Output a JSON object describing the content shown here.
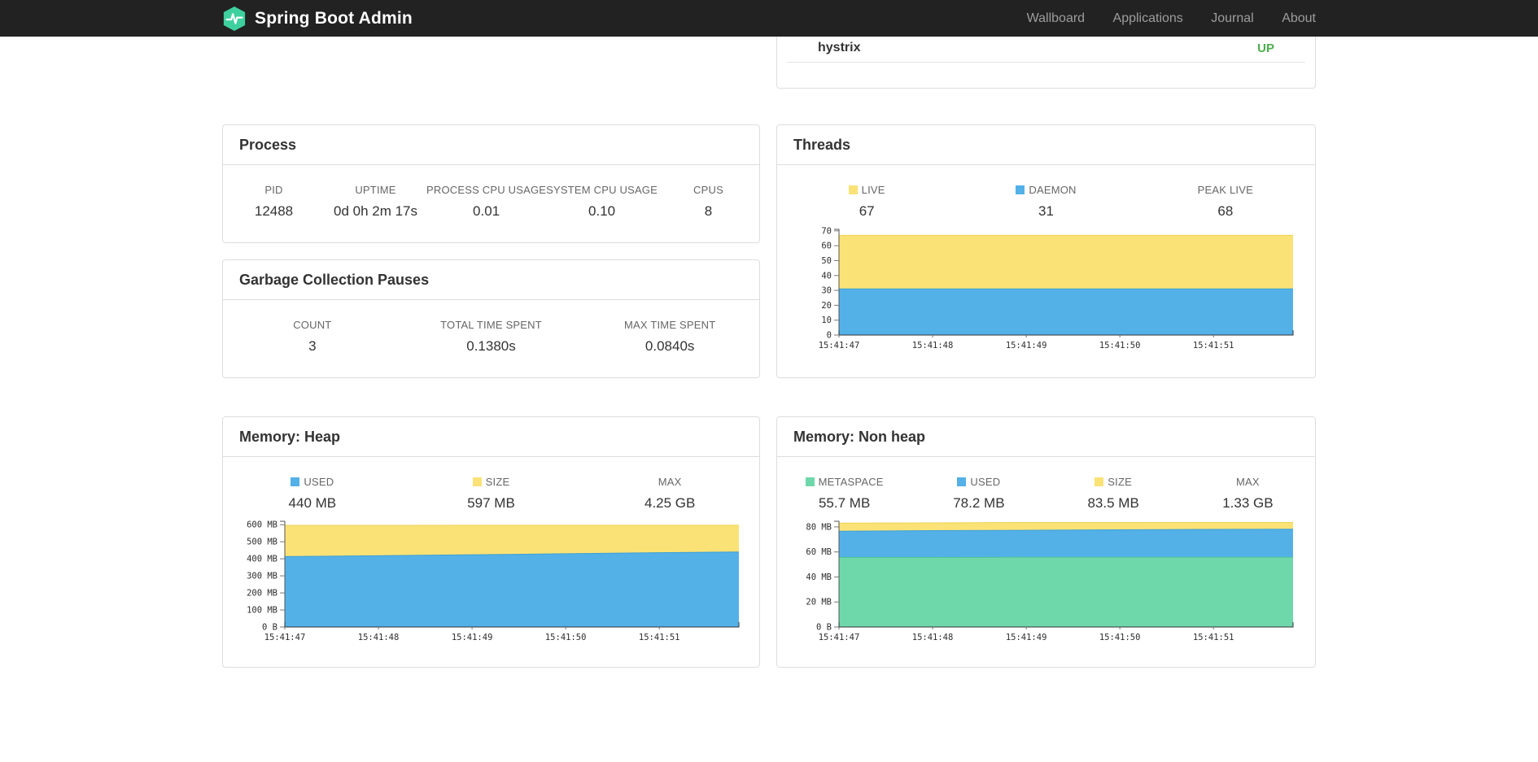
{
  "navbar": {
    "brand": "Spring Boot Admin",
    "links": [
      "Wallboard",
      "Applications",
      "Journal",
      "About"
    ]
  },
  "health": {
    "item": "hystrix",
    "status": "UP",
    "status_color": "#4cae4c"
  },
  "process": {
    "title": "Process",
    "metrics": [
      {
        "label": "PID",
        "value": "12488"
      },
      {
        "label": "UPTIME",
        "value": "0d 0h 2m 17s"
      },
      {
        "label": "PROCESS CPU USAGE",
        "value": "0.01"
      },
      {
        "label": "SYSTEM CPU USAGE",
        "value": "0.10"
      },
      {
        "label": "CPUS",
        "value": "8"
      }
    ]
  },
  "gc": {
    "title": "Garbage Collection Pauses",
    "metrics": [
      {
        "label": "COUNT",
        "value": "3"
      },
      {
        "label": "TOTAL TIME SPENT",
        "value": "0.1380s"
      },
      {
        "label": "MAX TIME SPENT",
        "value": "0.0840s"
      }
    ]
  },
  "threads": {
    "title": "Threads",
    "legend": [
      {
        "label": "LIVE",
        "value": "67",
        "swatch": "#fbe276"
      },
      {
        "label": "DAEMON",
        "value": "31",
        "swatch": "#53b1e8"
      },
      {
        "label": "PEAK LIVE",
        "value": "68",
        "swatch": null
      }
    ]
  },
  "heap": {
    "title": "Memory: Heap",
    "legend": [
      {
        "label": "USED",
        "value": "440 MB",
        "swatch": "#53b1e8"
      },
      {
        "label": "SIZE",
        "value": "597 MB",
        "swatch": "#fbe276"
      },
      {
        "label": "MAX",
        "value": "4.25 GB",
        "swatch": null
      }
    ]
  },
  "nonheap": {
    "title": "Memory: Non heap",
    "legend": [
      {
        "label": "METASPACE",
        "value": "55.7 MB",
        "swatch": "#6fd8ab"
      },
      {
        "label": "USED",
        "value": "78.2 MB",
        "swatch": "#53b1e8"
      },
      {
        "label": "SIZE",
        "value": "83.5 MB",
        "swatch": "#fbe276"
      },
      {
        "label": "MAX",
        "value": "1.33 GB",
        "swatch": null
      }
    ]
  },
  "chart_data": [
    {
      "id": "threads-chart",
      "type": "area",
      "title": "Threads",
      "y_max": 71,
      "y_ticks": [
        [
          0,
          "0"
        ],
        [
          10,
          "10"
        ],
        [
          20,
          "20"
        ],
        [
          30,
          "30"
        ],
        [
          40,
          "40"
        ],
        [
          50,
          "50"
        ],
        [
          60,
          "60"
        ],
        [
          70,
          "70"
        ]
      ],
      "x_max": 4.85,
      "x_tick_positions": [
        0,
        1,
        2,
        3,
        4
      ],
      "x_tick_labels": [
        "15:41:47",
        "15:41:48",
        "15:41:49",
        "15:41:50",
        "15:41:51"
      ],
      "series": [
        {
          "name": "DAEMON",
          "color": "#53b1e8",
          "line": "#3d9fd6",
          "values": [
            31,
            31,
            31,
            31,
            31,
            31
          ]
        },
        {
          "name": "LIVE",
          "color": "#fbe276",
          "line": "#eed250",
          "values": [
            67,
            67,
            67,
            67,
            67,
            67
          ]
        }
      ]
    },
    {
      "id": "heap-chart",
      "type": "area",
      "title": "Memory: Heap",
      "y_max": 620,
      "y_ticks": [
        [
          0,
          "0 B"
        ],
        [
          100,
          "100 MB"
        ],
        [
          200,
          "200 MB"
        ],
        [
          300,
          "300 MB"
        ],
        [
          400,
          "400 MB"
        ],
        [
          500,
          "500 MB"
        ],
        [
          600,
          "600 MB"
        ]
      ],
      "x_max": 4.85,
      "x_tick_positions": [
        0,
        1,
        2,
        3,
        4
      ],
      "x_tick_labels": [
        "15:41:47",
        "15:41:48",
        "15:41:49",
        "15:41:50",
        "15:41:51"
      ],
      "series": [
        {
          "name": "USED",
          "color": "#53b1e8",
          "line": "#3d9fd6",
          "values": [
            413,
            418,
            423,
            429,
            435,
            440
          ]
        },
        {
          "name": "SIZE",
          "color": "#fbe276",
          "line": "#eed250",
          "values": [
            596,
            596,
            597,
            597,
            597,
            597
          ]
        }
      ]
    },
    {
      "id": "nonheap-chart",
      "type": "area",
      "title": "Memory: Non heap",
      "y_max": 84.5,
      "y_ticks": [
        [
          0,
          "0 B"
        ],
        [
          20,
          "20 MB"
        ],
        [
          40,
          "40 MB"
        ],
        [
          60,
          "60 MB"
        ],
        [
          80,
          "80 MB"
        ]
      ],
      "x_max": 4.85,
      "x_tick_positions": [
        0,
        1,
        2,
        3,
        4
      ],
      "x_tick_labels": [
        "15:41:47",
        "15:41:48",
        "15:41:49",
        "15:41:50",
        "15:41:51"
      ],
      "series": [
        {
          "name": "METASPACE",
          "color": "#6fd8ab",
          "line": "#4fc694",
          "values": [
            55.6,
            55.6,
            55.7,
            55.7,
            55.7,
            55.7
          ]
        },
        {
          "name": "USED",
          "color": "#53b1e8",
          "line": "#3d9fd6",
          "values": [
            76.5,
            77,
            77.3,
            77.7,
            78,
            78.2
          ]
        },
        {
          "name": "SIZE",
          "color": "#fbe276",
          "line": "#eed250",
          "values": [
            83,
            83.2,
            83.5,
            83.5,
            83.5,
            83.5
          ]
        }
      ]
    }
  ]
}
